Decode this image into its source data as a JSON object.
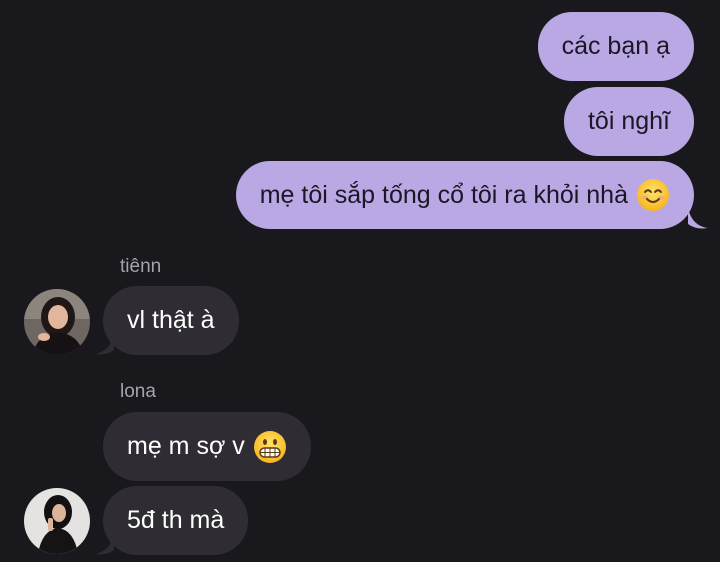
{
  "messages": {
    "out1": "các bạn ạ",
    "out2": "tôi nghĩ",
    "out3": "mẹ tôi sắp tống cổ tôi ra khỏi nhà",
    "in1_sender": "tiênn",
    "in1": "vl thật à",
    "in2_sender": "lona",
    "in2": "mẹ m sợ v",
    "in3": "5đ th mà"
  },
  "icons": {
    "out3_emoji": "smiling-face-icon",
    "in2_emoji": "grimacing-face-icon"
  },
  "colors": {
    "background": "#19181c",
    "outgoing_bubble": "#b9a8e3",
    "incoming_bubble": "#2f2d33"
  }
}
